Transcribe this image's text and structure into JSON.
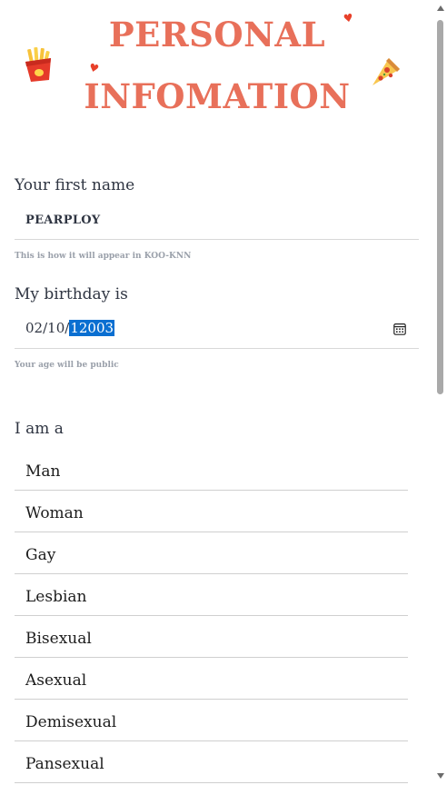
{
  "header": {
    "title_line1": "PERSONAL",
    "title_line2": "INFOMATION",
    "accent_color": "#e8705a",
    "decorations": [
      "fries-icon",
      "pizza-icon",
      "heart-icon",
      "heart-icon"
    ]
  },
  "first_name": {
    "label": "Your first name",
    "value": "PEARPLOY",
    "hint": "This is how it will appear in KOO-KNN"
  },
  "birthday": {
    "label": "My birthday is",
    "day": "02",
    "month": "10",
    "year": "12003",
    "separator": "/",
    "hint": "Your age will be public",
    "icon": "calendar-icon"
  },
  "gender": {
    "label": "I am a",
    "options": [
      "Man",
      "Woman",
      "Gay",
      "Lesbian",
      "Bisexual",
      "Asexual",
      "Demisexual",
      "Pansexual"
    ]
  }
}
